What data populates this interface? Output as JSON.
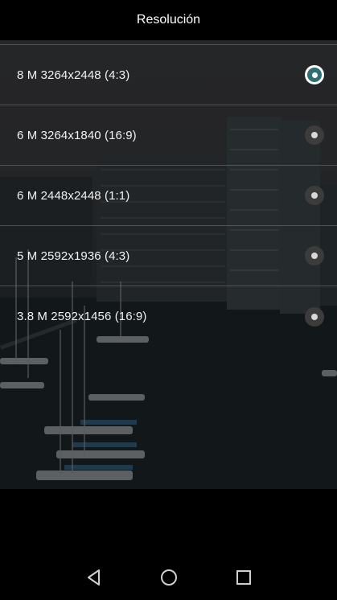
{
  "header": {
    "title": "Resolución"
  },
  "options": [
    {
      "label": "8 M 3264x2448 (4:3)",
      "selected": true
    },
    {
      "label": "6 M 3264x1840 (16:9)",
      "selected": false
    },
    {
      "label": "6 M 2448x2448 (1:1)",
      "selected": false
    },
    {
      "label": "5 M 2592x1936 (4:3)",
      "selected": false
    },
    {
      "label": "3.8 M 2592x1456 (16:9)",
      "selected": false
    }
  ],
  "colors": {
    "accent": "#2e6f74",
    "background": "#000000"
  },
  "navbar": {
    "icons": [
      "back-icon",
      "home-icon",
      "recents-icon"
    ]
  }
}
